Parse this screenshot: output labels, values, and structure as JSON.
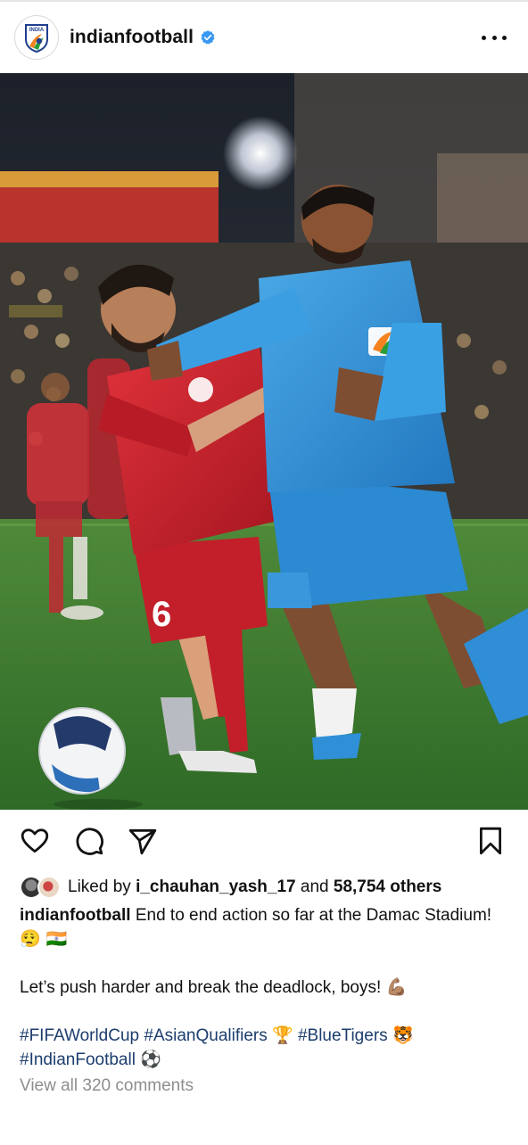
{
  "post": {
    "account": {
      "username": "indianfootball",
      "verified": true,
      "avatar_icon": "aiff-logo-icon",
      "avatar_text": "INDIA"
    },
    "menu_icon": "more-options-icon",
    "photo": {
      "subject": "football-match-photo",
      "player_jersey_number": "6"
    },
    "actions": {
      "like_icon": "heart-icon",
      "comment_icon": "comment-bubble-icon",
      "share_icon": "paper-plane-icon",
      "save_icon": "bookmark-icon"
    },
    "likes": {
      "prefix": "Liked by",
      "first_user": "i_chauhan_yash_17",
      "and": "and",
      "others": "58,754 others"
    },
    "caption": {
      "username": "indianfootball",
      "line1": "End to end action so far at the Damac Stadium!",
      "line1_emojis": "😮‍💨 🇮🇳",
      "line2": "Let’s push harder and break the deadlock, boys!",
      "line2_emoji": "💪🏽",
      "hashtags": [
        {
          "tag": "#FIFAWorldCup"
        },
        {
          "tag": "#AsianQualifiers",
          "emoji": "🏆"
        },
        {
          "tag": "#BlueTigers",
          "emoji": "🐯"
        },
        {
          "tag": "#IndianFootball",
          "emoji": "⚽"
        }
      ]
    },
    "comments_link": "View all 320 comments"
  },
  "colors": {
    "text": "#111111",
    "muted": "#8e8e8e",
    "hashtag": "#1c3d6e",
    "verified": "#3897f0",
    "india_jersey": "#2e8fd6",
    "opponent_jersey": "#c8202a",
    "pitch": "#3f7a32"
  }
}
